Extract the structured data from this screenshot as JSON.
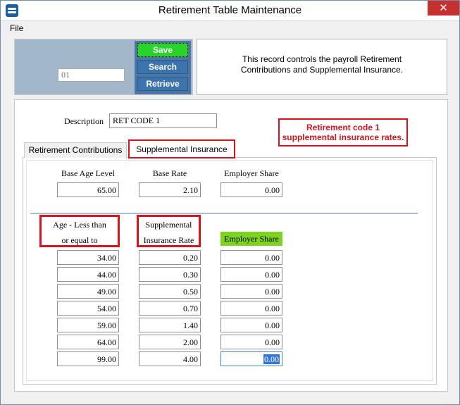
{
  "window": {
    "title": "Retirement Table Maintenance",
    "close_glyph": "✕"
  },
  "menu": {
    "file": "File"
  },
  "record": {
    "code_placeholder": "01"
  },
  "toolbar": {
    "save": "Save",
    "search": "Search",
    "retrieve": "Retrieve"
  },
  "info": {
    "line1": "This record controls the payroll Retirement",
    "line2": "Contributions and Supplemental Insurance."
  },
  "description": {
    "label": "Description",
    "value": "RET CODE 1"
  },
  "annotation": {
    "line1": "Retirement code 1",
    "line2": "supplemental insurance rates."
  },
  "tabs": {
    "retirement": "Retirement Contributions",
    "supplemental": "Supplemental Insurance"
  },
  "base": {
    "age_label": "Base Age Level",
    "age_value": "65.00",
    "rate_label": "Base Rate",
    "rate_value": "2.10",
    "share_label": "Employer Share",
    "share_value": "0.00"
  },
  "table": {
    "age_header_line1": "Age - Less than",
    "age_header_line2": "or equal to",
    "rate_header_line1": "Supplemental",
    "rate_header_line2": "Insurance Rate",
    "share_header": "Employer Share",
    "rows": [
      {
        "age": "34.00",
        "rate": "0.20",
        "share": "0.00"
      },
      {
        "age": "44.00",
        "rate": "0.30",
        "share": "0.00"
      },
      {
        "age": "49.00",
        "rate": "0.50",
        "share": "0.00"
      },
      {
        "age": "54.00",
        "rate": "0.70",
        "share": "0.00"
      },
      {
        "age": "59.00",
        "rate": "1.40",
        "share": "0.00"
      },
      {
        "age": "64.00",
        "rate": "2.00",
        "share": "0.00"
      },
      {
        "age": "99.00",
        "rate": "4.00",
        "share": "0.00"
      }
    ]
  },
  "colors": {
    "accent_red": "#d9121b",
    "save_green": "#29d32a",
    "header_green": "#7ed321"
  }
}
